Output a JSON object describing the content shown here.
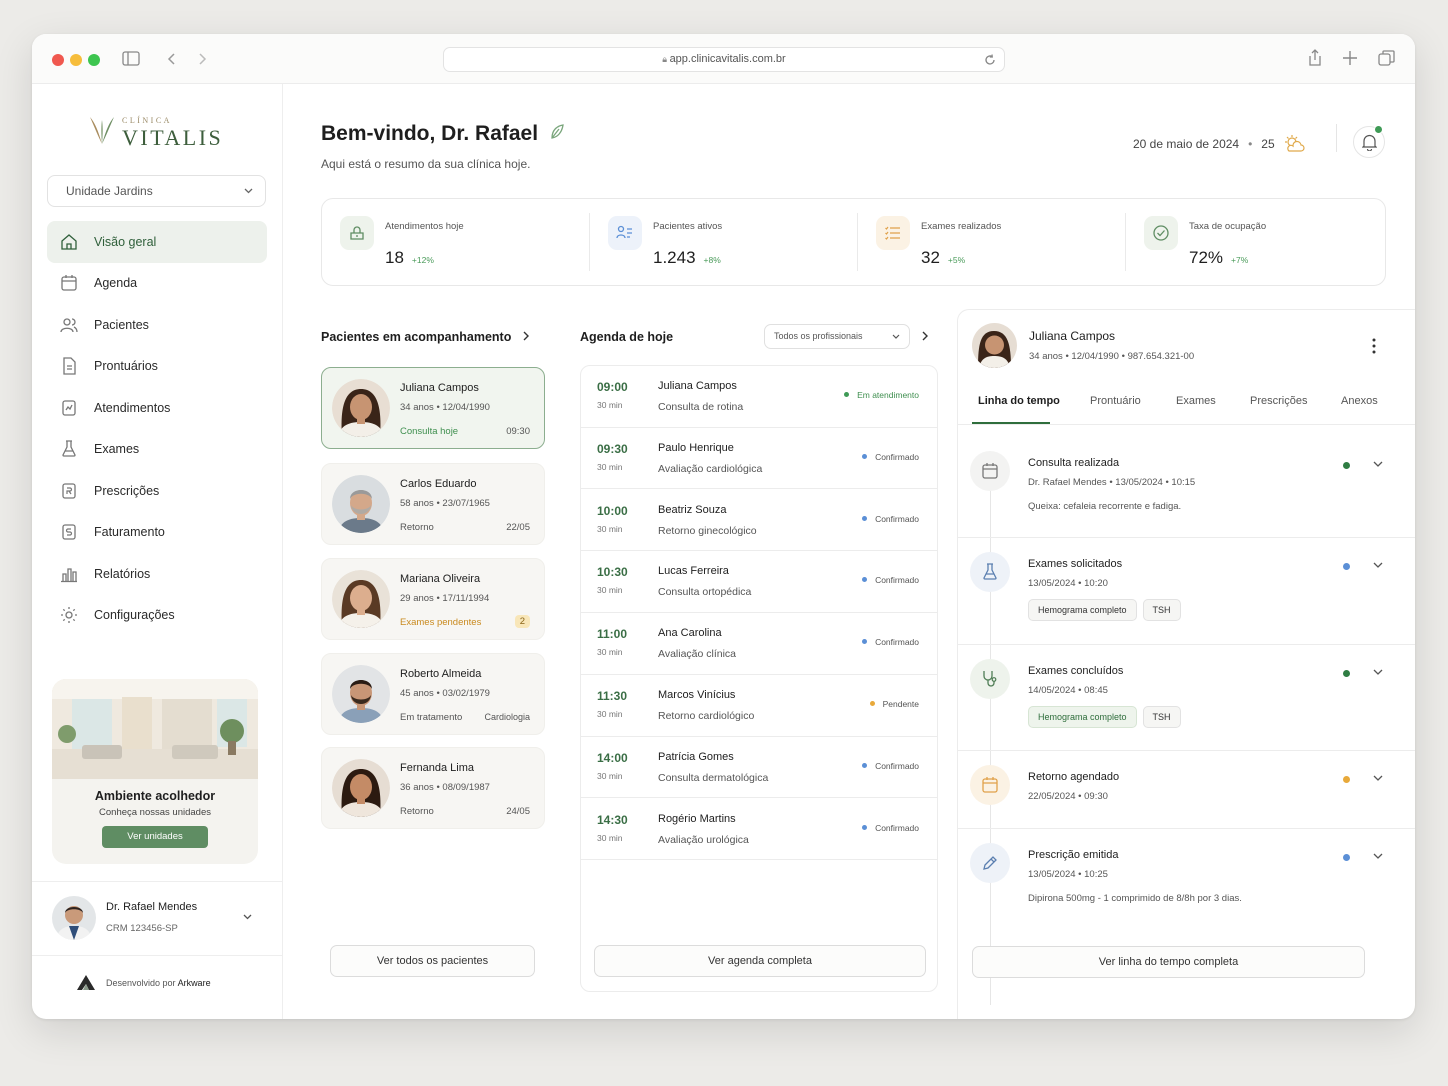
{
  "browser": {
    "url": "app.clinicavitalis.com.br"
  },
  "brand": {
    "small": "CLÍNICA",
    "name": "VITALIS"
  },
  "sidebar": {
    "unit": "Unidade Jardins",
    "items": [
      {
        "label": "Visão geral"
      },
      {
        "label": "Agenda"
      },
      {
        "label": "Pacientes"
      },
      {
        "label": "Prontuários"
      },
      {
        "label": "Atendimentos"
      },
      {
        "label": "Exames"
      },
      {
        "label": "Prescrições"
      },
      {
        "label": "Faturamento"
      },
      {
        "label": "Relatórios"
      },
      {
        "label": "Configurações"
      }
    ],
    "promo": {
      "title": "Ambiente acolhedor",
      "subtitle": "Conheça nossas unidades",
      "button": "Ver unidades"
    },
    "user": {
      "name": "Dr. Rafael Mendes",
      "crm": "CRM 123456-SP"
    },
    "footer": {
      "prefix": "Desenvolvido por",
      "brand": "Arkware"
    }
  },
  "header": {
    "title": "Bem-vindo, Dr. Rafael",
    "subtitle": "Aqui está o resumo da sua clínica hoje.",
    "date": "20 de maio de 2024",
    "temp": "25"
  },
  "stats": [
    {
      "label": "Atendimentos hoje",
      "value": "18",
      "delta": "+12%"
    },
    {
      "label": "Pacientes ativos",
      "value": "1.243",
      "delta": "+8%"
    },
    {
      "label": "Exames realizados",
      "value": "32",
      "delta": "+5%"
    },
    {
      "label": "Taxa de ocupação",
      "value": "72%",
      "delta": "+7%"
    }
  ],
  "patients": {
    "title": "Pacientes em acompanhamento",
    "button": "Ver todos os pacientes",
    "list": [
      {
        "name": "Juliana Campos",
        "meta": "34 anos  •  12/04/1990",
        "status": "Consulta hoje",
        "right": "09:30"
      },
      {
        "name": "Carlos Eduardo",
        "meta": "58 anos  •  23/07/1965",
        "status": "Retorno",
        "right": "22/05"
      },
      {
        "name": "Mariana Oliveira",
        "meta": "29 anos  •  17/11/1994",
        "status": "Exames pendentes",
        "right": "2"
      },
      {
        "name": "Roberto Almeida",
        "meta": "45 anos  •  03/02/1979",
        "status": "Em tratamento",
        "right": "Cardiologia"
      },
      {
        "name": "Fernanda Lima",
        "meta": "36 anos  •  08/09/1987",
        "status": "Retorno",
        "right": "24/05"
      }
    ]
  },
  "agenda": {
    "title": "Agenda de hoje",
    "filter": "Todos os profissionais",
    "button": "Ver agenda completa",
    "rows": [
      {
        "time": "09:00",
        "dur": "30 min",
        "name": "Juliana Campos",
        "type": "Consulta de rotina",
        "status": "Em atendimento",
        "color": "#3f9a56"
      },
      {
        "time": "09:30",
        "dur": "30 min",
        "name": "Paulo Henrique",
        "type": "Avaliação cardiológica",
        "status": "Confirmado",
        "color": "#5b8fd6"
      },
      {
        "time": "10:00",
        "dur": "30 min",
        "name": "Beatriz Souza",
        "type": "Retorno ginecológico",
        "status": "Confirmado",
        "color": "#5b8fd6"
      },
      {
        "time": "10:30",
        "dur": "30 min",
        "name": "Lucas Ferreira",
        "type": "Consulta ortopédica",
        "status": "Confirmado",
        "color": "#5b8fd6"
      },
      {
        "time": "11:00",
        "dur": "30 min",
        "name": "Ana Carolina",
        "type": "Avaliação clínica",
        "status": "Confirmado",
        "color": "#5b8fd6"
      },
      {
        "time": "11:30",
        "dur": "30 min",
        "name": "Marcos Vinícius",
        "type": "Retorno cardiológico",
        "status": "Pendente",
        "color": "#e8a93a"
      },
      {
        "time": "14:00",
        "dur": "30 min",
        "name": "Patrícia Gomes",
        "type": "Consulta dermatológica",
        "status": "Confirmado",
        "color": "#5b8fd6"
      },
      {
        "time": "14:30",
        "dur": "30 min",
        "name": "Rogério Martins",
        "type": "Avaliação urológica",
        "status": "Confirmado",
        "color": "#5b8fd6"
      }
    ]
  },
  "detail": {
    "name": "Juliana Campos",
    "meta": "34 anos  •  12/04/1990  •  987.654.321-00",
    "tabs": [
      "Linha do tempo",
      "Prontuário",
      "Exames",
      "Prescrições",
      "Anexos"
    ],
    "button": "Ver linha do tempo completa",
    "timeline": [
      {
        "title": "Consulta realizada",
        "meta": "Dr. Rafael Mendes  •  13/05/2024  •  10:15",
        "note": "Queixa: cefaleia recorrente e fadiga.",
        "color": "#2f7d43"
      },
      {
        "title": "Exames solicitados",
        "meta": "13/05/2024  •  10:20",
        "chips": [
          "Hemograma completo",
          "TSH"
        ],
        "color": "#5b8fd6"
      },
      {
        "title": "Exames concluídos",
        "meta": "14/05/2024  •  08:45",
        "chips": [
          "Hemograma completo",
          "TSH"
        ],
        "color": "#2f7d43"
      },
      {
        "title": "Retorno agendado",
        "meta": "22/05/2024  •  09:30",
        "color": "#e8a93a"
      },
      {
        "title": "Prescrição emitida",
        "meta": "13/05/2024  •  10:25",
        "note": "Dipirona 500mg - 1 comprimido de 8/8h por 3 dias.",
        "color": "#5b8fd6"
      }
    ]
  }
}
